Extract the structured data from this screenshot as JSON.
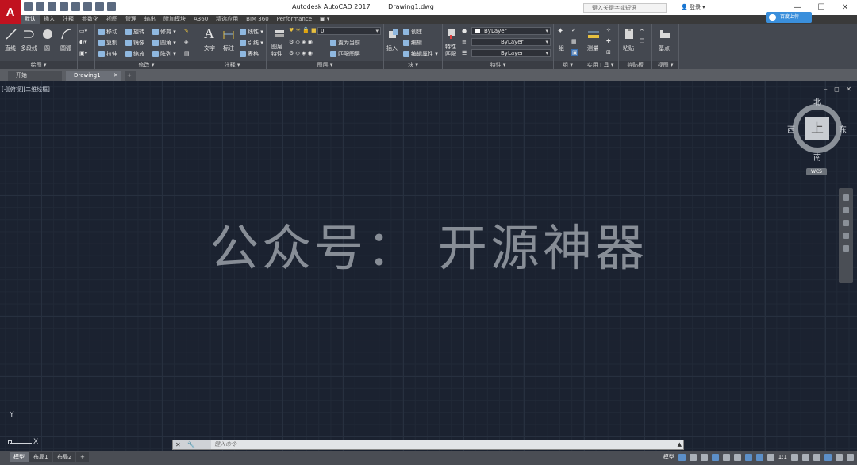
{
  "app": {
    "logo_letter": "A",
    "title": "Autodesk AutoCAD 2017",
    "filename": "Drawing1.dwg",
    "search_placeholder": "键入关键字或短语",
    "login": "登录",
    "cloud_button": "百度上传"
  },
  "window_buttons": [
    "—",
    "☐",
    "✕"
  ],
  "ribbon_tabs": [
    {
      "label": "默认",
      "active": true
    },
    {
      "label": "插入"
    },
    {
      "label": "注释"
    },
    {
      "label": "参数化"
    },
    {
      "label": "视图"
    },
    {
      "label": "管理"
    },
    {
      "label": "输出"
    },
    {
      "label": "附加模块"
    },
    {
      "label": "A360"
    },
    {
      "label": "精选应用"
    },
    {
      "label": "BIM 360"
    },
    {
      "label": "Performance"
    },
    {
      "label": "▣ ▾"
    }
  ],
  "panels": {
    "draw": {
      "title": "绘图 ▾",
      "line": "直线",
      "polyline": "多段线",
      "circle": "圆",
      "arc": "圆弧"
    },
    "modify": {
      "title": "修改 ▾",
      "move": "移动",
      "rotate": "旋转",
      "trim": "修剪",
      "copy": "复制",
      "mirror": "镜像",
      "fillet": "圆角",
      "stretch": "拉伸",
      "scale": "缩放",
      "array": "阵列"
    },
    "annotation": {
      "title": "注释 ▾",
      "text": "文字",
      "dimension": "标注",
      "linear": "线性",
      "leader": "引线",
      "table": "表格"
    },
    "layers": {
      "title": "图层 ▾",
      "layer_props": "图层特性",
      "layer_value": "0",
      "make_current": "置为当前",
      "match_layer": "匹配图层"
    },
    "block": {
      "title": "块 ▾",
      "insert": "插入",
      "create": "创建",
      "edit": "编辑",
      "edit_attr": "编辑属性"
    },
    "properties": {
      "title": "特性 ▾",
      "match": "特性匹配",
      "color": "ByLayer",
      "linetype": "ByLayer",
      "lineweight": "ByLayer"
    },
    "groups": {
      "title": "组 ▾",
      "group": "组"
    },
    "utilities": {
      "title": "实用工具 ▾",
      "measure": "测量"
    },
    "clipboard": {
      "title": "剪贴板",
      "paste": "粘贴"
    },
    "view": {
      "title": "视图 ▾",
      "base": "基点"
    }
  },
  "file_tabs": {
    "start": "开始",
    "drawing": "Drawing1",
    "close": "✕",
    "plus": "+"
  },
  "viewport": {
    "label": "[-][俯视][二维线框]",
    "controls": "– ◻ ✕"
  },
  "watermark": "公众号：  开源神器",
  "viewcube": {
    "north": "北",
    "south": "南",
    "east": "东",
    "west": "西",
    "face": "上",
    "wcs": "WCS"
  },
  "ucs": {
    "x": "X",
    "y": "Y"
  },
  "command_line": {
    "icons": "✕ 🔧 ▸▾",
    "placeholder": "键入命令",
    "history_arrow": "▲"
  },
  "layout_tabs": {
    "model": "模型",
    "layout1": "布局1",
    "layout2": "布局2",
    "add": "+"
  },
  "status_bar": {
    "model_label": "模型",
    "scale": "1:1"
  }
}
